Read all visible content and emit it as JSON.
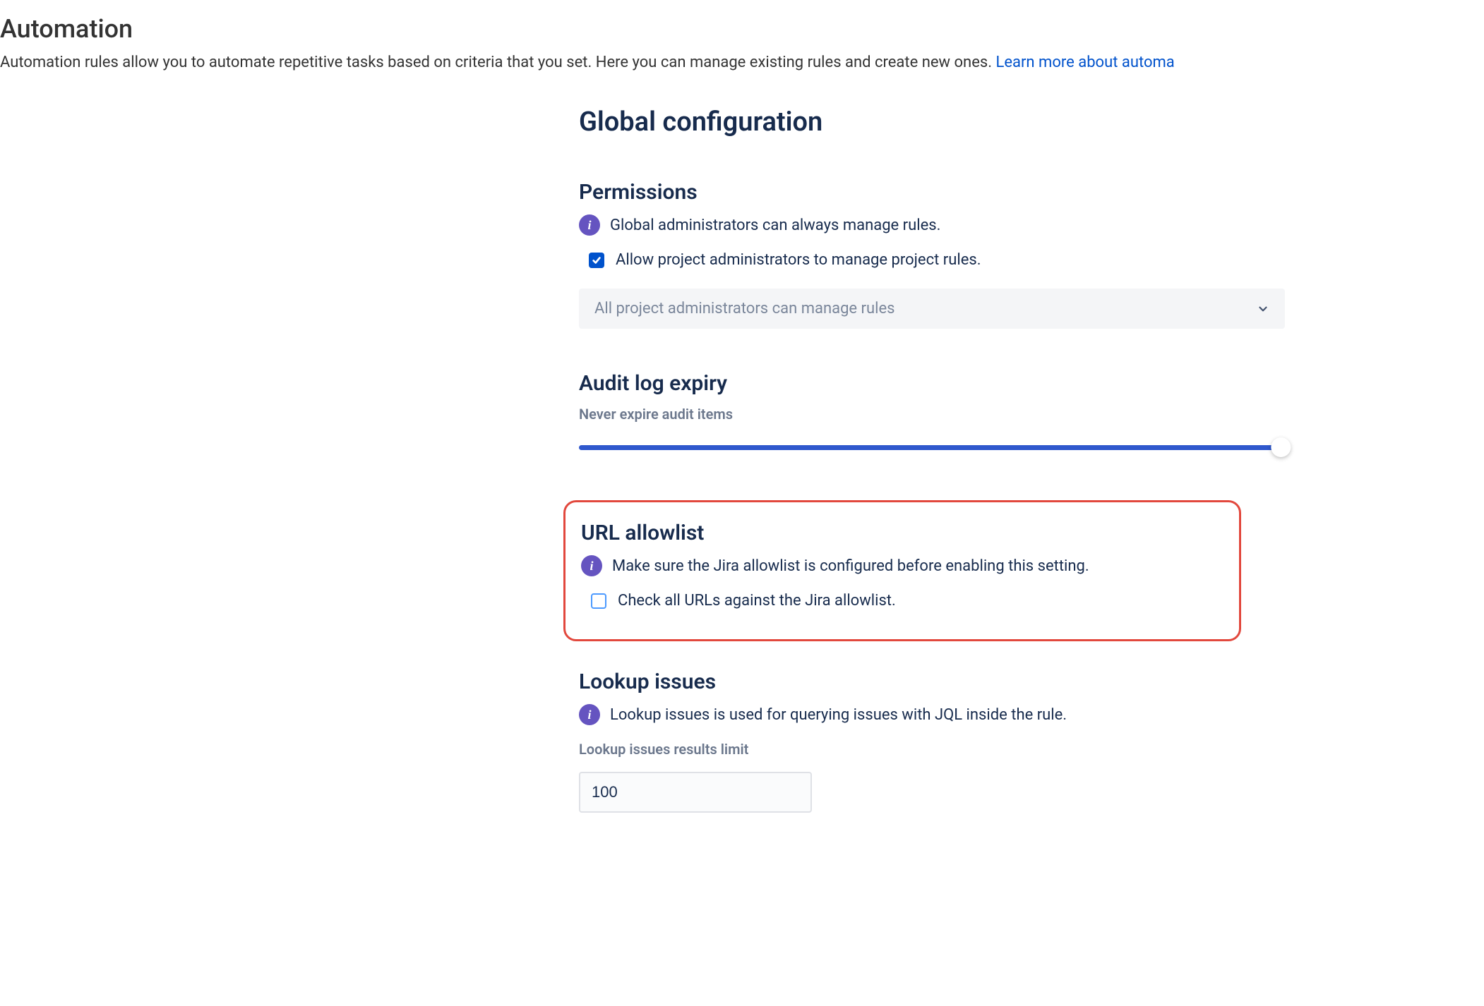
{
  "header": {
    "title": "Automation",
    "description": "Automation rules allow you to automate repetitive tasks based on criteria that you set. Here you can manage existing rules and create new ones. ",
    "learn_more": "Learn more about automa"
  },
  "global_config": {
    "title": "Global configuration"
  },
  "permissions": {
    "title": "Permissions",
    "info_text": "Global administrators can always manage rules.",
    "checkbox_label": "Allow project administrators to manage project rules.",
    "dropdown_value": "All project administrators can manage rules"
  },
  "audit": {
    "title": "Audit log expiry",
    "label": "Never expire audit items"
  },
  "url_allowlist": {
    "title": "URL allowlist",
    "info_text": "Make sure the Jira allowlist is configured before enabling this setting.",
    "checkbox_label": "Check all URLs against the Jira allowlist."
  },
  "lookup": {
    "title": "Lookup issues",
    "info_text": "Lookup issues is used for querying issues with JQL inside the rule.",
    "field_label": "Lookup issues results limit",
    "field_value": "100"
  }
}
